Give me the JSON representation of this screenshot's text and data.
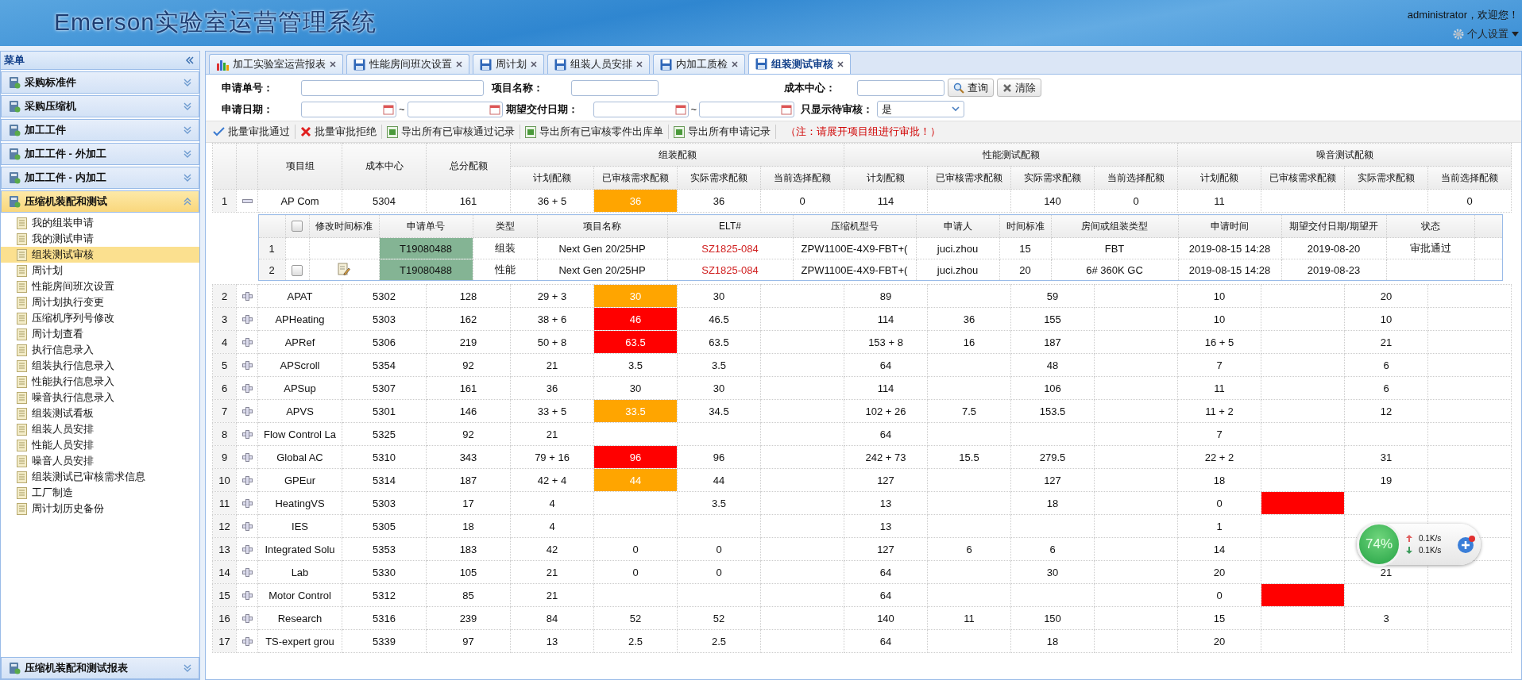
{
  "header": {
    "title": "Emerson实验室运营管理系统",
    "welcome": "administrator，欢迎您！",
    "settings": "个人设置"
  },
  "sidebar": {
    "title": "菜单",
    "groups": [
      {
        "label": "采购标准件",
        "expanded": false,
        "selected": false
      },
      {
        "label": "采购压缩机",
        "expanded": false,
        "selected": false
      },
      {
        "label": "加工工件",
        "expanded": false,
        "selected": false
      },
      {
        "label": "加工工件 - 外加工",
        "expanded": false,
        "selected": false
      },
      {
        "label": "加工工件 - 内加工",
        "expanded": false,
        "selected": false
      },
      {
        "label": "压缩机装配和测试",
        "expanded": true,
        "selected": true,
        "items": [
          {
            "label": "我的组装申请",
            "selected": false
          },
          {
            "label": "我的测试申请",
            "selected": false
          },
          {
            "label": "组装测试审核",
            "selected": true
          },
          {
            "label": "周计划",
            "selected": false
          },
          {
            "label": "性能房间班次设置",
            "selected": false
          },
          {
            "label": "周计划执行变更",
            "selected": false
          },
          {
            "label": "压缩机序列号修改",
            "selected": false
          },
          {
            "label": "周计划查看",
            "selected": false
          },
          {
            "label": "执行信息录入",
            "selected": false
          },
          {
            "label": "组装执行信息录入",
            "selected": false
          },
          {
            "label": "性能执行信息录入",
            "selected": false
          },
          {
            "label": "噪音执行信息录入",
            "selected": false
          },
          {
            "label": "组装测试看板",
            "selected": false
          },
          {
            "label": "组装人员安排",
            "selected": false
          },
          {
            "label": "性能人员安排",
            "selected": false
          },
          {
            "label": "噪音人员安排",
            "selected": false
          },
          {
            "label": "组装测试已审核需求信息",
            "selected": false
          },
          {
            "label": "工厂制造",
            "selected": false
          },
          {
            "label": "周计划历史备份",
            "selected": false
          }
        ]
      },
      {
        "label": "压缩机装配和测试报表",
        "expanded": false,
        "selected": false
      }
    ]
  },
  "tabs": [
    {
      "label": "加工实验室运营报表",
      "selected": false
    },
    {
      "label": "性能房间班次设置",
      "selected": false
    },
    {
      "label": "周计划",
      "selected": false
    },
    {
      "label": "组装人员安排",
      "selected": false
    },
    {
      "label": "内加工质检",
      "selected": false
    },
    {
      "label": "组装测试审核",
      "selected": true
    }
  ],
  "filters": {
    "request_no_label": "申请单号：",
    "project_name_label": "项目名称：",
    "cost_center_label": "成本中心：",
    "request_date": {
      "label": "申请日期：",
      "separator": "~"
    },
    "delivery_date": {
      "label": "期望交付日期：",
      "separator": "~"
    },
    "pending_only": {
      "label": "只显示待审核：",
      "value": "是"
    },
    "buttons": [
      "查询",
      "清除"
    ]
  },
  "toolbar": {
    "actions": [
      "批量审批通过",
      "批量审批拒绝",
      "导出所有已审核通过记录",
      "导出所有已审核零件出库单",
      "导出所有申请记录"
    ],
    "note": "（注：请展开项目组进行审批！）"
  },
  "table": {
    "columns": [
      "项目组",
      "成本中心",
      "总分配额"
    ],
    "group_headers": [
      "组装配额",
      "性能测试配额",
      "噪音测试配额"
    ],
    "sub_columns": [
      "计划配额",
      "已审核需求配额",
      "实际需求配额",
      "当前选择配额",
      "计划配额",
      "已审核需求配额",
      "实际需求配额",
      "当前选择配额",
      "计划配额",
      "已审核需求配额",
      "实际需求配额",
      "当前选择配额"
    ],
    "rows": [
      {
        "index": "1",
        "expanded": true,
        "cells": [
          "AP Com",
          "5304",
          "161",
          "36 + 5",
          {
            "text": "36",
            "color": "#ffa500"
          },
          "36",
          "0",
          "114",
          null,
          "140",
          "0",
          "11",
          null,
          null,
          "0"
        ],
        "detail": {
          "header_checked": false,
          "columns": [
            "修改时间标准",
            "申请单号",
            "类型",
            "项目名称",
            "ELT#",
            "压缩机型号",
            "申请人",
            "时间标准",
            "房间或组装类型",
            "申请时间",
            "期望交付日期/期望开",
            "状态"
          ],
          "rows": [
            {
              "index": "1",
              "editable": false,
              "cells": [
                "",
                "T19080488",
                "组装",
                "Next Gen 20/25HP",
                "SZ1825-084",
                "ZPW1100E-4X9-FBT+(",
                "juci.zhou",
                "15",
                "FBT",
                "2019-08-15 14:28",
                "2019-08-20",
                "审批通过"
              ]
            },
            {
              "index": "2",
              "editable": true,
              "checked": false,
              "cells": [
                "",
                "T19080488",
                "性能",
                "Next Gen 20/25HP",
                "SZ1825-084",
                "ZPW1100E-4X9-FBT+(",
                "juci.zhou",
                "20",
                "6# 360K GC",
                "2019-08-15 14:28",
                "2019-08-23",
                ""
              ]
            }
          ]
        }
      },
      {
        "index": "2",
        "expanded": false,
        "cells": [
          "APAT",
          "5302",
          "128",
          "29 + 3",
          {
            "text": "30",
            "color": "#ffa500"
          },
          "30",
          null,
          "89",
          null,
          "59",
          null,
          "10",
          null,
          "20",
          null
        ]
      },
      {
        "index": "3",
        "expanded": false,
        "cells": [
          "APHeating",
          "5303",
          "162",
          "38 + 6",
          {
            "text": "46",
            "color": "#ff0000"
          },
          "46.5",
          null,
          "114",
          "36",
          "155",
          null,
          "10",
          null,
          "10",
          null
        ]
      },
      {
        "index": "4",
        "expanded": false,
        "cells": [
          "APRef",
          "5306",
          "219",
          "50 + 8",
          {
            "text": "63.5",
            "color": "#ff0000"
          },
          "63.5",
          null,
          "153 + 8",
          "16",
          "187",
          null,
          "16 + 5",
          null,
          "21",
          null
        ]
      },
      {
        "index": "5",
        "expanded": false,
        "cells": [
          "APScroll",
          "5354",
          "92",
          "21",
          "3.5",
          "3.5",
          null,
          "64",
          null,
          "48",
          null,
          "7",
          null,
          "6",
          null
        ]
      },
      {
        "index": "6",
        "expanded": false,
        "cells": [
          "APSup",
          "5307",
          "161",
          "36",
          "30",
          "30",
          null,
          "114",
          null,
          "106",
          null,
          "11",
          null,
          "6",
          null
        ]
      },
      {
        "index": "7",
        "expanded": false,
        "cells": [
          "APVS",
          "5301",
          "146",
          "33 + 5",
          {
            "text": "33.5",
            "color": "#ffa500"
          },
          "34.5",
          null,
          "102 + 26",
          "7.5",
          "153.5",
          null,
          "11 + 2",
          null,
          "12",
          null
        ]
      },
      {
        "index": "8",
        "expanded": false,
        "cells": [
          "Flow Control La",
          "5325",
          "92",
          "21",
          null,
          null,
          null,
          "64",
          null,
          null,
          null,
          "7",
          null,
          null,
          null
        ]
      },
      {
        "index": "9",
        "expanded": false,
        "cells": [
          "Global AC",
          "5310",
          "343",
          "79 + 16",
          {
            "text": "96",
            "color": "#ff0000"
          },
          "96",
          null,
          "242 + 73",
          "15.5",
          "279.5",
          null,
          "22 + 2",
          null,
          "31",
          null
        ]
      },
      {
        "index": "10",
        "expanded": false,
        "cells": [
          "GPEur",
          "5314",
          "187",
          "42 + 4",
          {
            "text": "44",
            "color": "#ffa500"
          },
          "44",
          null,
          "127",
          null,
          "127",
          null,
          "18",
          null,
          "19",
          null
        ]
      },
      {
        "index": "11",
        "expanded": false,
        "cells": [
          "HeatingVS",
          "5303",
          "17",
          "4",
          null,
          "3.5",
          null,
          "13",
          null,
          "18",
          null,
          "0",
          {
            "text": null,
            "color": "#ff0000"
          },
          null,
          null
        ]
      },
      {
        "index": "12",
        "expanded": false,
        "cells": [
          "IES",
          "5305",
          "18",
          "4",
          null,
          null,
          null,
          "13",
          null,
          null,
          null,
          "1",
          null,
          null,
          null
        ]
      },
      {
        "index": "13",
        "expanded": false,
        "cells": [
          "Integrated Solu",
          "5353",
          "183",
          "42",
          "0",
          "0",
          null,
          "127",
          "6",
          "6",
          null,
          "14",
          null,
          null,
          null
        ]
      },
      {
        "index": "14",
        "expanded": false,
        "cells": [
          "Lab",
          "5330",
          "105",
          "21",
          "0",
          "0",
          null,
          "64",
          null,
          "30",
          null,
          "20",
          null,
          "21",
          null
        ]
      },
      {
        "index": "15",
        "expanded": false,
        "cells": [
          "Motor Control",
          "5312",
          "85",
          "21",
          null,
          null,
          null,
          "64",
          null,
          null,
          null,
          "0",
          {
            "text": null,
            "color": "#ff0000"
          },
          null,
          null
        ]
      },
      {
        "index": "16",
        "expanded": false,
        "cells": [
          "Research",
          "5316",
          "239",
          "84",
          "52",
          "52",
          null,
          "140",
          "11",
          "150",
          null,
          "15",
          null,
          "3",
          null
        ]
      },
      {
        "index": "17",
        "expanded": false,
        "cells": [
          "TS-expert grou",
          "5339",
          "97",
          "13",
          "2.5",
          "2.5",
          null,
          "64",
          null,
          "18",
          null,
          "20",
          null,
          null,
          null
        ]
      }
    ]
  },
  "speed_widget": {
    "percent": "74%",
    "upload": "0.1K/s",
    "download": "0.1K/s"
  }
}
